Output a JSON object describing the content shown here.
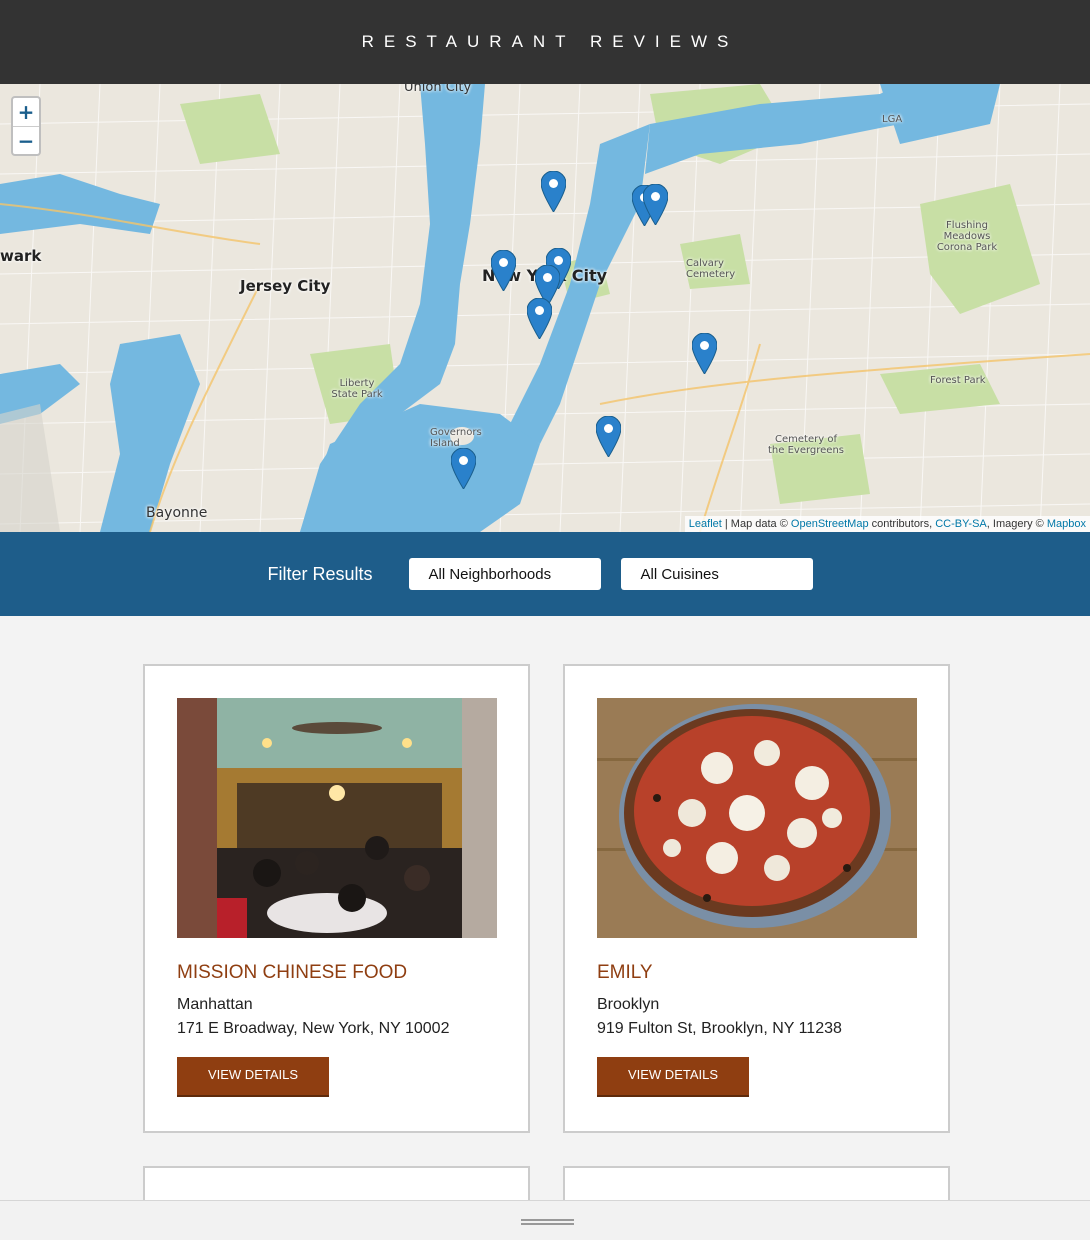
{
  "header": {
    "title": "RESTAURANT REVIEWS"
  },
  "map": {
    "zoom_in": "+",
    "zoom_out": "−",
    "labels": {
      "union_city": "Union City",
      "new_york_city": "New York City",
      "jersey_city": "Jersey City",
      "newark": "wark",
      "bayonne": "Bayonne",
      "liberty_state_park": "Liberty State Park",
      "governors_island": "Governors Island",
      "calvary_cemetery": "Calvary Cemetery",
      "flushing_meadows": "Flushing Meadows Corona Park",
      "forest_park": "Forest Park",
      "cemetery_evergreens": "Cemetery of the Evergreens",
      "lga": "LGA"
    },
    "attribution": {
      "leaflet": "Leaflet",
      "map_data": "| Map data ©",
      "osm": "OpenStreetMap",
      "contributors": "contributors,",
      "license": "CC-BY-SA",
      "imagery": ", Imagery ©",
      "mapbox": "Mapbox"
    },
    "marker_color": "#2a81cb"
  },
  "filter": {
    "label": "Filter Results",
    "neighborhood_value": "All Neighborhoods",
    "cuisine_value": "All Cuisines"
  },
  "restaurants": [
    {
      "name": "MISSION CHINESE FOOD",
      "neighborhood": "Manhattan",
      "address": "171 E Broadway, New York, NY 10002",
      "button": "VIEW DETAILS"
    },
    {
      "name": "EMILY",
      "neighborhood": "Brooklyn",
      "address": "919 Fulton St, Brooklyn, NY 11238",
      "button": "VIEW DETAILS"
    }
  ],
  "colors": {
    "header_bg": "#333333",
    "filter_bg": "#1e5d8a",
    "accent": "#8f3e11",
    "water": "#74b8e0",
    "park": "#c8dfa5"
  }
}
